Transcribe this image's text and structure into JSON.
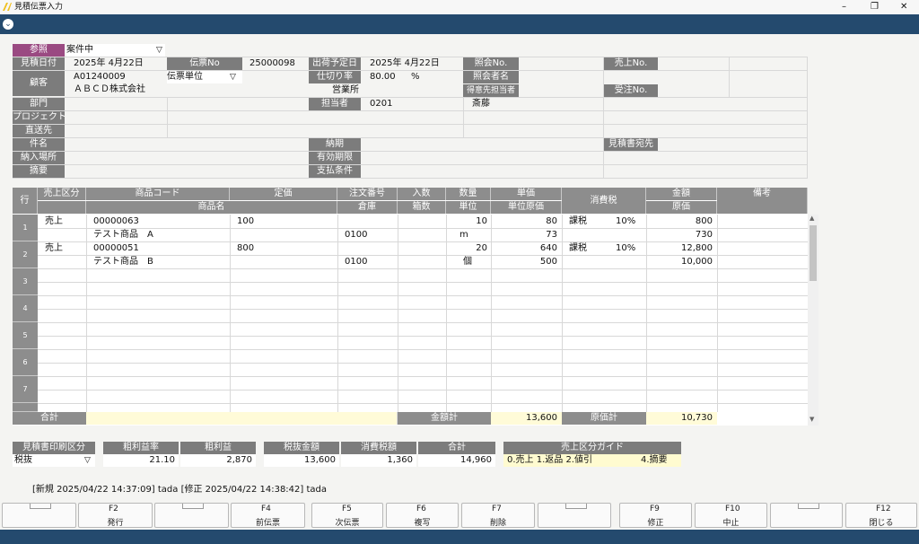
{
  "window": {
    "title": "見積伝票入力",
    "minimize": "–",
    "maximize": "❐",
    "close": "✕"
  },
  "menu": {
    "dropdown_icon": "chevron-down"
  },
  "header": {
    "sansho_label": "参照",
    "sansho_value": "案件中",
    "mitsumori_date_label": "見積日付",
    "mitsumori_date": "2025年  4月22日",
    "denpyo_no_label": "伝票No",
    "denpyo_no": "25000098",
    "shukka_label": "出荷予定日",
    "shukka_date": "2025年  4月22日",
    "shokai_no_label": "照会No.",
    "uriage_no_label": "売上No.",
    "kokyaku_label": "顧客",
    "kokyaku_code": "A01240009",
    "kokyaku_name": "ＡＢＣＤ株式会社",
    "denpyo_tani": "伝票単位",
    "shikiri_label": "仕切り率",
    "shikiri_value": "80.00",
    "shikiri_unit": "%",
    "shokaisha_label": "照会者名",
    "eigyosho": "営業所",
    "tokui_label": "得意先担当者",
    "juchu_label": "受注No.",
    "bumon_label": "部門",
    "tantosha_label": "担当者",
    "tantosha_code": "0201",
    "tantosha_name": "斎藤",
    "project_label": "プロジェクト",
    "chokuso_label": "直送先",
    "kenmei_label": "件名",
    "noki_label": "納期",
    "atesaki_label": "見積書宛先",
    "nonyu_label": "納入場所",
    "yuko_label": "有効期限",
    "tekiyo_label": "摘要",
    "shiharai_label": "支払条件"
  },
  "grid": {
    "h_gyo": "行",
    "h_kubun": "売上区分",
    "h_code": "商品コード",
    "h_teika": "定価",
    "h_chumon": "注文番号",
    "h_irisu": "入数",
    "h_suryo": "数量",
    "h_tanka": "単価",
    "h_zei": "消費税",
    "h_kingaku": "金額",
    "h_biko": "備考",
    "h_name": "商品名",
    "h_soko": "倉庫",
    "h_hakosu": "箱数",
    "h_tani": "単位",
    "h_genka_tanka": "単位原価",
    "h_genka": "原価",
    "rows": [
      {
        "no": "1",
        "kubun": "売上",
        "code": "00000063",
        "teika": "100",
        "suryo": "10",
        "tanka": "80",
        "zei_kbn": "課税",
        "zei_rate": "10%",
        "kingaku": "800",
        "name": "テスト商品　A",
        "soko": "0100",
        "tani": "m",
        "genka_tanka": "73",
        "genka": "730"
      },
      {
        "no": "2",
        "kubun": "売上",
        "code": "00000051",
        "teika": "800",
        "suryo": "20",
        "tanka": "640",
        "zei_kbn": "課税",
        "zei_rate": "10%",
        "kingaku": "12,800",
        "name": "テスト商品　B",
        "soko": "0100",
        "tani": "個",
        "genka_tanka": "500",
        "genka": "10,000"
      }
    ],
    "empty_rows": [
      "3",
      "4",
      "5",
      "6",
      "7"
    ],
    "total_label": "合計",
    "kingaku_kei_label": "金額計",
    "kingaku_kei": "13,600",
    "genka_kei_label": "原価計",
    "genka_kei": "10,730"
  },
  "summary": {
    "insatsu_label": "見積書印刷区分",
    "insatsu_value": "税抜",
    "arari_ritsu_label": "粗利益率",
    "arari_ritsu": "21.10",
    "arari_label": "粗利益",
    "arari": "2,870",
    "zeinuki_label": "税抜金額",
    "zeinuki": "13,600",
    "zeigaku_label": "消費税額",
    "zeigaku": "1,360",
    "gokei_label": "合計",
    "gokei": "14,960",
    "guide_label": "売上区分ガイド",
    "guide_text": "0.売上  1.返品  2.値引",
    "guide_text2": "4.摘要"
  },
  "audit": {
    "text": "[新規 2025/04/22 14:37:09] tada   [修正 2025/04/22 14:38:42] tada"
  },
  "fkeys": [
    {
      "key": "",
      "label": ""
    },
    {
      "key": "F2",
      "label": "発行"
    },
    {
      "key": "",
      "label": ""
    },
    {
      "key": "F4",
      "label": "前伝票"
    },
    {
      "key": "F5",
      "label": "次伝票"
    },
    {
      "key": "F6",
      "label": "複写"
    },
    {
      "key": "F7",
      "label": "削除"
    },
    {
      "key": "",
      "label": ""
    },
    {
      "key": "F9",
      "label": "修正"
    },
    {
      "key": "F10",
      "label": "中止"
    },
    {
      "key": "",
      "label": ""
    },
    {
      "key": "F12",
      "label": "閉じる"
    }
  ]
}
